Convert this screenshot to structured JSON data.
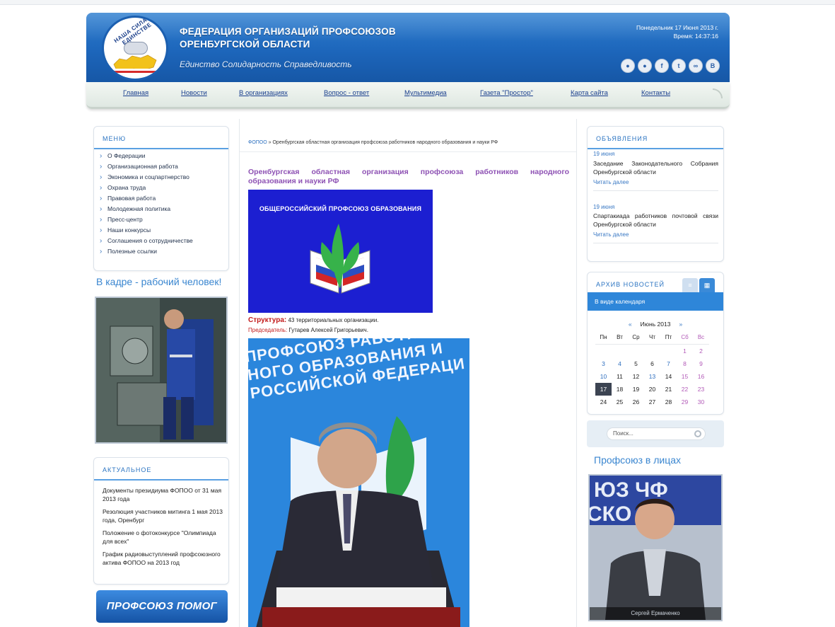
{
  "header": {
    "org_title_line1": "ФЕДЕРАЦИЯ ОРГАНИЗАЦИЙ ПРОФСОЮЗОВ",
    "org_title_line2": "ОРЕНБУРГСКОЙ ОБЛАСТИ",
    "slogan": "Единство Солидарность Справедливость",
    "date": "Понедельник 17 Июня 2013 г.",
    "time": "Время: 14:37:16",
    "logo_text": "НАША СИЛА В ЕДИНСТВЕ",
    "social_icons": [
      "people-icon",
      "group-icon",
      "facebook-icon",
      "twitter-icon",
      "paperclip-icon",
      "vkontakte-icon"
    ]
  },
  "nav": {
    "items": [
      "Главная",
      "Новости",
      "В организациях",
      "Вопрос - ответ",
      "Мультимедиа",
      "Газета \"Простор\"",
      "Карта сайта",
      "Контакты"
    ]
  },
  "left": {
    "menu_title": "МЕНЮ",
    "menu_items": [
      "О Федерации",
      "Организационная работа",
      "Экономика и соцпартнерство",
      "Охрана труда",
      "Правовая работа",
      "Молодежная политика",
      "Пресс-центр",
      "Наши конкурсы",
      "Соглашения о сотрудничестве",
      "Полезные ссылки"
    ],
    "photo_heading": "В кадре - рабочий человек!",
    "actual_title": "АКТУАЛЬНОЕ",
    "actual_items": [
      "Документы президиума ФОПОО от 31 мая 2013 года",
      "Резолюция участников митинга 1 мая 2013 года, Оренбург",
      "Положение о фотоконкурсе \"Олимпиада для всех\"",
      "График радиовыступлений профсоюзного актива ФОПОО на 2013 год"
    ],
    "banner": "ПРОФСОЮЗ ПОМОГ"
  },
  "center": {
    "crumb_home": "ФОПОО",
    "crumb_sep": " » ",
    "crumb_current": "Оренбургская областная организация профсоюза работников народного образования и науки РФ",
    "title": "Оренбургская областная организация профсоюза работников народного образования и науки РФ",
    "logo_caption": "ОБЩЕРОССИЙСКИЙ ПРОФСОЮЗ ОБРАЗОВАНИЯ",
    "structure_label": "Структура:",
    "structure_value": " 43 территориальных организации.",
    "chair_label": "Председатель:",
    "chair_value": " Гутарев Алексей Григорьевич.",
    "portrait_banner": "ПРОФСОЮЗ РАБОТНИКОВ\nНОГО ОБРАЗОВАНИЯ И\nРОССИЙСКОЙ ФЕДЕРАЦИ"
  },
  "right": {
    "ann_title": "ОБЪЯВЛЕНИЯ",
    "announcements": [
      {
        "date": "19 июня",
        "text": "Заседание Законодательного Собрания Оренбургской области",
        "more": "Читать далее"
      },
      {
        "date": "19 июня",
        "text": "Спартакиада работников почтовой связи Оренбургской области",
        "more": "Читать далее"
      }
    ],
    "archive_title": "АРХИВ НОВОСТЕЙ",
    "calendar_bar": "В виде календаря",
    "calendar_prev": "«",
    "calendar_month": "Июнь 2013",
    "calendar_next": "»",
    "weekdays": [
      "Пн",
      "Вт",
      "Ср",
      "Чт",
      "Пт",
      "Сб",
      "Вс"
    ],
    "search_placeholder": "Поиск...",
    "faces_heading": "Профсоюз в лицах",
    "person_caption": "Сергей Ермаченко"
  },
  "calendar_data": {
    "days": [
      [
        "",
        "",
        "",
        "",
        "",
        "1",
        "2"
      ],
      [
        "3",
        "4",
        "5",
        "6",
        "7",
        "8",
        "9"
      ],
      [
        "10",
        "11",
        "12",
        "13",
        "14",
        "15",
        "16"
      ],
      [
        "17",
        "18",
        "19",
        "20",
        "21",
        "22",
        "23"
      ],
      [
        "24",
        "25",
        "26",
        "27",
        "28",
        "29",
        "30"
      ]
    ],
    "today": "17",
    "linked_days": [
      "3",
      "4",
      "7",
      "10",
      "13"
    ]
  }
}
